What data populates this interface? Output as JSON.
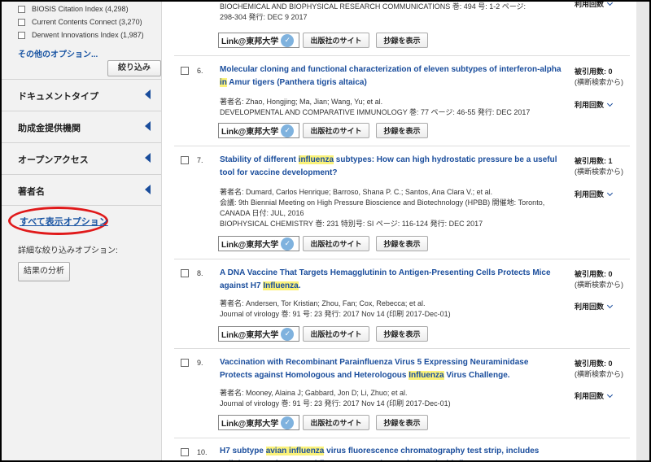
{
  "sidebar": {
    "facet_options": [
      {
        "label": "BIOSIS Citation Index (4,298)"
      },
      {
        "label": "Current Contents Connect (3,270)"
      },
      {
        "label": "Derwent Innovations Index (1,987)"
      }
    ],
    "more_options": "その他のオプション...",
    "refine_button": "絞り込み",
    "sections": [
      {
        "label": "ドキュメントタイプ"
      },
      {
        "label": "助成金提供機関"
      },
      {
        "label": "オープンアクセス"
      },
      {
        "label": "著者名"
      }
    ],
    "view_all_options": "すべて表示オプション",
    "advanced_refine_label": "詳細な絞り込みオプション:",
    "analyze_button": "結果の分析"
  },
  "buttons": {
    "link_label": "Link@東邦大学",
    "publisher_site": "出版社のサイト",
    "show_abstract": "抄録を表示"
  },
  "records": [
    {
      "num": "",
      "meta_lines": [
        "BIOCHEMICAL AND BIOPHYSICAL RESEARCH COMMUNICATIONS  巻: 494  号: 1-2  ページ:",
        "298-304  発行: DEC 9 2017"
      ],
      "cite_count": "",
      "cite_note": "",
      "usage": "利用回数"
    },
    {
      "num": "6.",
      "title_parts": [
        {
          "text": "Molecular cloning and functional characterization of eleven subtypes of interferon-alpha ",
          "hl": false
        },
        {
          "text": "in",
          "hl": true
        },
        {
          "text": " Amur tigers (Panthera tigris altaica)",
          "hl": false
        }
      ],
      "meta_lines": [
        "著者名: Zhao, Hongjing; Ma, Jian; Wang, Yu; et al.",
        "DEVELOPMENTAL AND COMPARATIVE IMMUNOLOGY  巻: 77  ページ: 46-55  発行: DEC 2017"
      ],
      "cite_count": "被引用数: 0",
      "cite_note": "(横断検索から)",
      "usage": "利用回数"
    },
    {
      "num": "7.",
      "title_parts": [
        {
          "text": "Stability of different ",
          "hl": false
        },
        {
          "text": "influenza",
          "hl": true
        },
        {
          "text": " subtypes: How can high hydrostatic pressure be a useful tool for vaccine development?",
          "hl": false
        }
      ],
      "meta_lines": [
        "著者名: Dumard, Carlos Henrique; Barroso, Shana P. C.; Santos, Ana Clara V.; et al.",
        "会議: 9th Biennial Meeting on High Pressure Bioscience and Biotechnology (HPBB) 開催地: Toronto,",
        "CANADA 日付: JUL, 2016",
        "BIOPHYSICAL CHEMISTRY  巻: 231  特別号: SI  ページ: 116-124  発行: DEC 2017"
      ],
      "cite_count": "被引用数: 1",
      "cite_note": "(横断検索から)",
      "usage": "利用回数"
    },
    {
      "num": "8.",
      "title_parts": [
        {
          "text": "A DNA Vaccine That Targets Hemagglutinin to Antigen-Presenting Cells Protects Mice against H7 ",
          "hl": false
        },
        {
          "text": "Influenza",
          "hl": true
        },
        {
          "text": ".",
          "hl": false
        }
      ],
      "meta_lines": [
        "著者名: Andersen, Tor Kristian; Zhou, Fan; Cox, Rebecca; et al.",
        "Journal of virology  巻: 91  号: 23    発行: 2017 Nov 14 (印刷 2017-Dec-01)"
      ],
      "cite_count": "被引用数: 0",
      "cite_note": "(横断検索から)",
      "usage": "利用回数"
    },
    {
      "num": "9.",
      "title_parts": [
        {
          "text": "Vaccination with Recombinant Parainfluenza Virus 5 Expressing Neuraminidase Protects against Homologous and Heterologous ",
          "hl": false
        },
        {
          "text": "Influenza",
          "hl": true
        },
        {
          "text": " Virus Challenge.",
          "hl": false
        }
      ],
      "meta_lines": [
        "著者名: Mooney, Alaina J; Gabbard, Jon D; Li, Zhuo; et al.",
        "Journal of virology  巻: 91  号: 23    発行: 2017 Nov 14 (印刷 2017-Dec-01)"
      ],
      "cite_count": "被引用数: 0",
      "cite_note": "(横断検索から)",
      "usage": "利用回数"
    },
    {
      "num": "10.",
      "title_parts": [
        {
          "text": "H7 subtype ",
          "hl": false
        },
        {
          "text": "avian influenza",
          "hl": true
        },
        {
          "text": " virus fluorescence chromatography test strip, includes cellulose membrane, and fluorescent marker pad coated with fluorescent",
          "hl": false
        }
      ]
    }
  ],
  "colors": {
    "accent": "#1a4d9c",
    "highlight": "#fbf27a",
    "annotation_circle": "#e0191a"
  }
}
